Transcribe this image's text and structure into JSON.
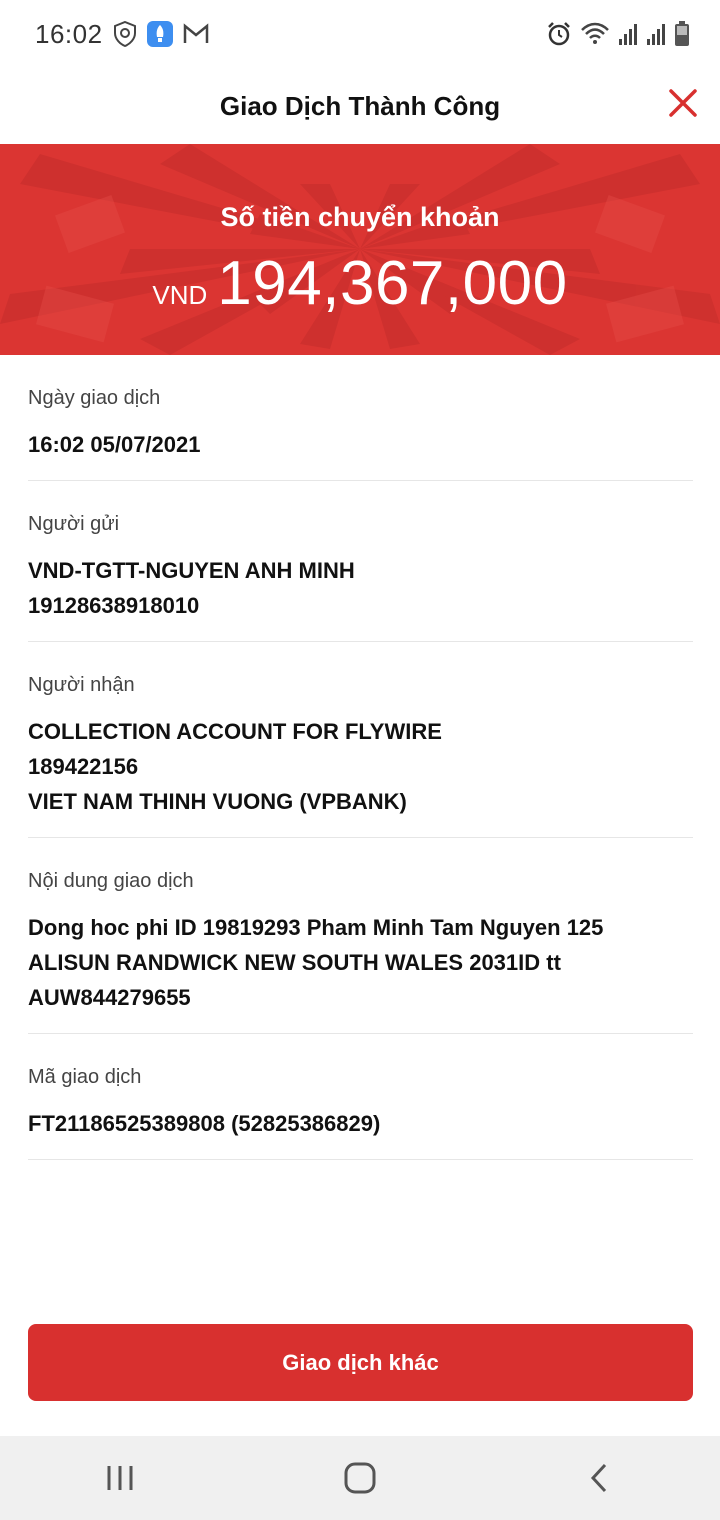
{
  "status_bar": {
    "time": "16:02",
    "left_icons": [
      "shield-app-icon",
      "rocket-app-icon",
      "gmail-icon"
    ],
    "right_icons": [
      "alarm-icon",
      "wifi-icon",
      "signal-icon",
      "signal-icon",
      "battery-icon"
    ]
  },
  "header": {
    "title": "Giao Dịch Thành Công",
    "close_icon": "close-icon"
  },
  "banner": {
    "label": "Số tiền chuyển khoản",
    "currency": "VND",
    "amount": "194,367,000",
    "background_color": "#db3532"
  },
  "details": {
    "date": {
      "label": "Ngày giao dịch",
      "lines": [
        "16:02 05/07/2021"
      ]
    },
    "sender": {
      "label": "Người gửi",
      "lines": [
        "VND-TGTT-NGUYEN ANH MINH",
        "19128638918010"
      ]
    },
    "recipient": {
      "label": "Người nhận",
      "lines": [
        "COLLECTION ACCOUNT FOR FLYWIRE",
        "189422156",
        "VIET NAM THINH VUONG (VPBANK)"
      ]
    },
    "content": {
      "label": "Nội dung giao dịch",
      "lines": [
        "Dong hoc phi ID 19819293 Pham Minh Tam Nguyen 125",
        "ALISUN RANDWICK NEW SOUTH WALES 2031ID tt",
        "AUW844279655"
      ]
    },
    "code": {
      "label": "Mã giao dịch",
      "lines": [
        "FT21186525389808 (52825386829)"
      ]
    }
  },
  "action_button": {
    "label": "Giao dịch khác",
    "color": "#d8302f"
  },
  "nav_bar": {
    "icons": [
      "recent-apps-icon",
      "home-icon",
      "back-icon"
    ]
  }
}
